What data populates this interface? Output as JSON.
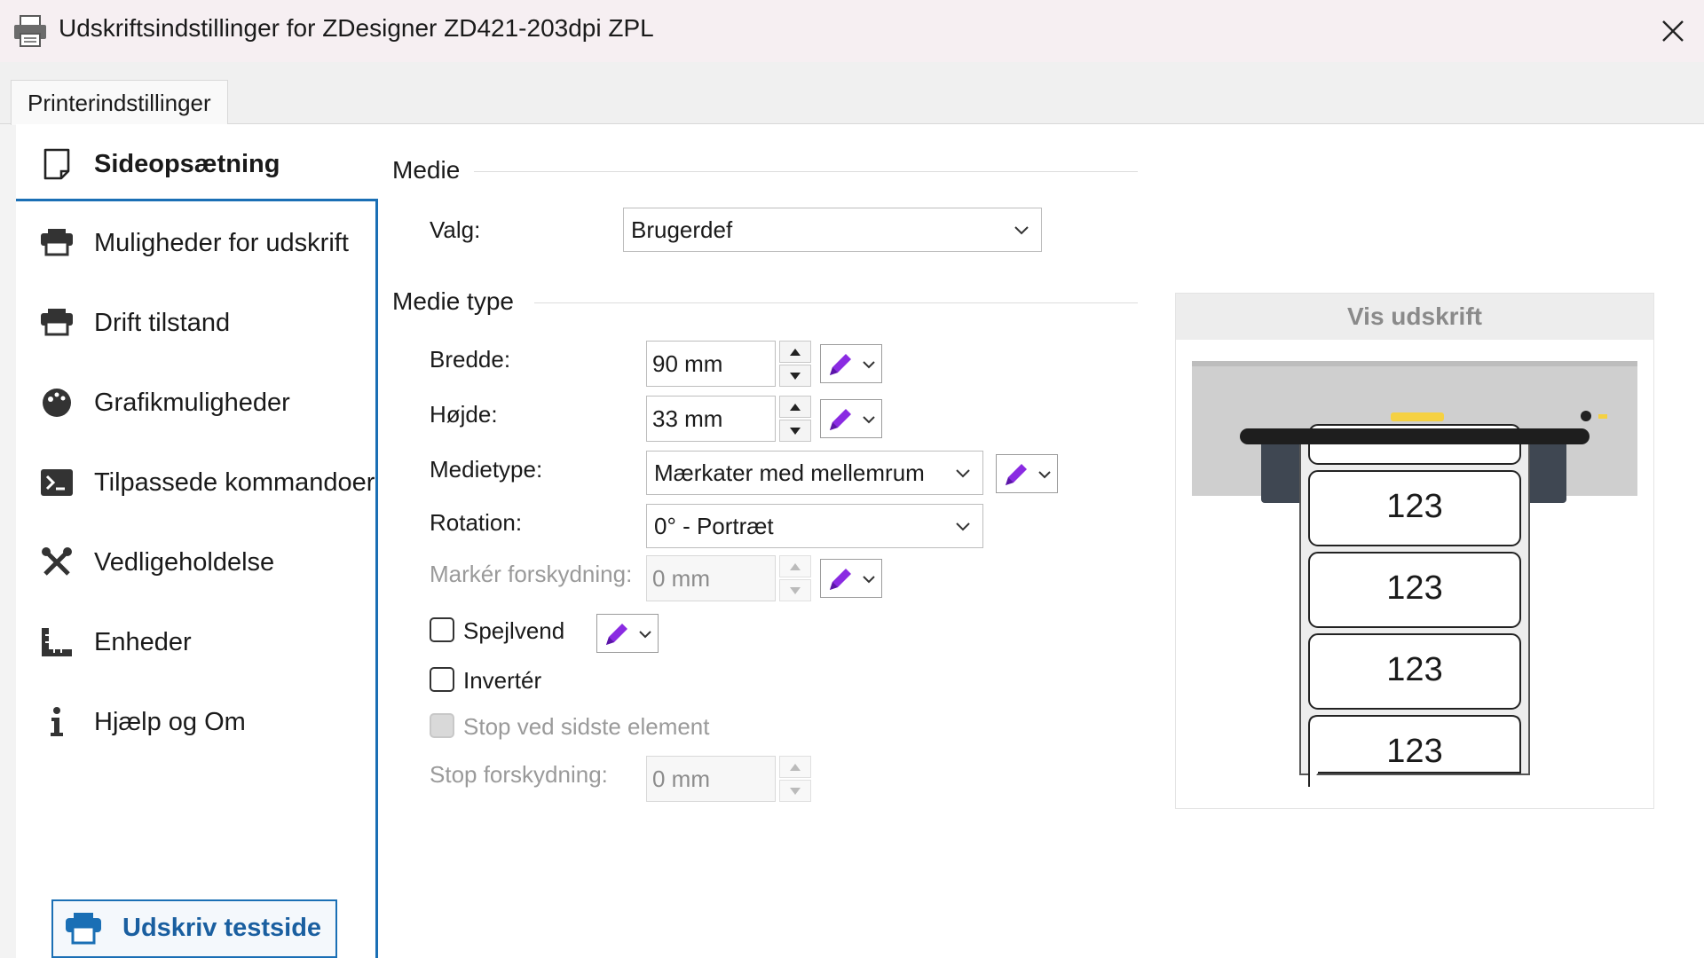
{
  "window": {
    "title": "Udskriftsindstillinger for ZDesigner ZD421-203dpi ZPL",
    "close_label": "✕"
  },
  "tabs": [
    {
      "label": "Printerindstillinger",
      "active": true
    }
  ],
  "sidebar": {
    "items": [
      {
        "label": "Sideopsætning",
        "icon": "page-icon",
        "active": true
      },
      {
        "label": "Muligheder for udskrift",
        "icon": "printer-icon",
        "active": false
      },
      {
        "label": "Drift tilstand",
        "icon": "printer-icon",
        "active": false
      },
      {
        "label": "Grafikmuligheder",
        "icon": "palette-icon",
        "active": false
      },
      {
        "label": "Tilpassede kommandoer",
        "icon": "terminal-icon",
        "active": false
      },
      {
        "label": "Vedligeholdelse",
        "icon": "tools-icon",
        "active": false
      },
      {
        "label": "Enheder",
        "icon": "ruler-icon",
        "active": false
      },
      {
        "label": "Hjælp og Om",
        "icon": "info-icon",
        "active": false
      }
    ],
    "test_button": {
      "label": "Udskriv testside",
      "icon": "printer-icon"
    }
  },
  "medie": {
    "section_title": "Medie",
    "valg_label": "Valg:",
    "valg_value": "Brugerdef"
  },
  "medie_type": {
    "section_title": "Medie type",
    "bredde_label": "Bredde:",
    "bredde_value": "90 mm",
    "hojde_label": "Højde:",
    "hojde_value": "33 mm",
    "medietype_label": "Medietype:",
    "medietype_value": "Mærkater med mellemrum",
    "rotation_label": "Rotation:",
    "rotation_value": "0° - Portræt",
    "marker_label": "Markér forskydning:",
    "marker_value": "0 mm",
    "spejlvend_label": "Spejlvend",
    "spejlvend_checked": false,
    "inverter_label": "Invertér",
    "inverter_checked": false,
    "stop_label": "Stop ved sidste element",
    "stop_checked": false,
    "stop_disabled": true,
    "stopforskydning_label": "Stop forskydning:",
    "stopforskydning_value": "0 mm"
  },
  "preview": {
    "title": "Vis udskrift",
    "label_text": "123",
    "label_count": 4
  },
  "colors": {
    "accent": "#1a6fb5",
    "pen": "#8a2be2",
    "printer_led": "#f5d142"
  }
}
